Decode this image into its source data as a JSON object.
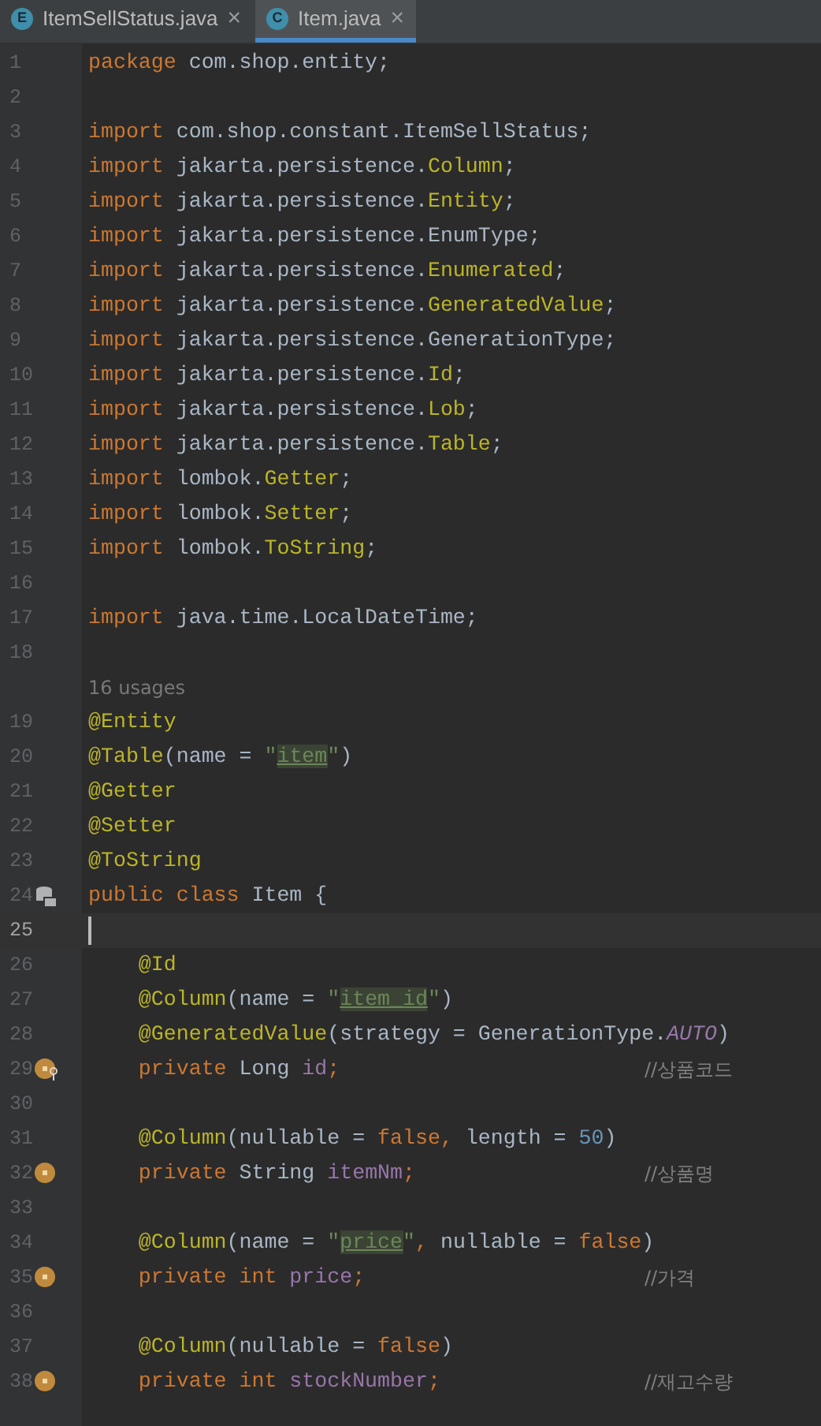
{
  "tabs": [
    {
      "label": "ItemSellStatus.java",
      "icon_letter": "E",
      "selected": false,
      "close": "×"
    },
    {
      "label": "Item.java",
      "icon_letter": "C",
      "selected": true,
      "close": "×"
    }
  ],
  "lines": [
    {
      "number": "1",
      "tokens": [
        {
          "text": "package",
          "kind": "keyword"
        },
        {
          "text": " com.shop.entity;",
          "kind": "plain"
        }
      ]
    },
    {
      "number": "2"
    },
    {
      "number": "3",
      "tokens": [
        {
          "text": "import",
          "kind": "keyword"
        },
        {
          "text": " com.shop.constant.ItemSellStatus;",
          "kind": "plain"
        }
      ]
    },
    {
      "number": "4",
      "tokens": [
        {
          "text": "import",
          "kind": "keyword"
        },
        {
          "text": " jakarta.persistence.",
          "kind": "plain"
        },
        {
          "text": "Column",
          "kind": "annotation"
        },
        {
          "text": ";",
          "kind": "plain"
        }
      ]
    },
    {
      "number": "5",
      "tokens": [
        {
          "text": "import",
          "kind": "keyword"
        },
        {
          "text": " jakarta.persistence.",
          "kind": "plain"
        },
        {
          "text": "Entity",
          "kind": "annotation"
        },
        {
          "text": ";",
          "kind": "plain"
        }
      ]
    },
    {
      "number": "6",
      "tokens": [
        {
          "text": "import",
          "kind": "keyword"
        },
        {
          "text": " jakarta.persistence.EnumType;",
          "kind": "plain"
        }
      ]
    },
    {
      "number": "7",
      "tokens": [
        {
          "text": "import",
          "kind": "keyword"
        },
        {
          "text": " jakarta.persistence.",
          "kind": "plain"
        },
        {
          "text": "Enumerated",
          "kind": "annotation"
        },
        {
          "text": ";",
          "kind": "plain"
        }
      ]
    },
    {
      "number": "8",
      "tokens": [
        {
          "text": "import",
          "kind": "keyword"
        },
        {
          "text": " jakarta.persistence.",
          "kind": "plain"
        },
        {
          "text": "GeneratedValue",
          "kind": "annotation"
        },
        {
          "text": ";",
          "kind": "plain"
        }
      ]
    },
    {
      "number": "9",
      "tokens": [
        {
          "text": "import",
          "kind": "keyword"
        },
        {
          "text": " jakarta.persistence.GenerationType;",
          "kind": "plain"
        }
      ]
    },
    {
      "number": "10",
      "tokens": [
        {
          "text": "import",
          "kind": "keyword"
        },
        {
          "text": " jakarta.persistence.",
          "kind": "plain"
        },
        {
          "text": "Id",
          "kind": "annotation"
        },
        {
          "text": ";",
          "kind": "plain"
        }
      ]
    },
    {
      "number": "11",
      "tokens": [
        {
          "text": "import",
          "kind": "keyword"
        },
        {
          "text": " jakarta.persistence.",
          "kind": "plain"
        },
        {
          "text": "Lob",
          "kind": "annotation"
        },
        {
          "text": ";",
          "kind": "plain"
        }
      ]
    },
    {
      "number": "12",
      "tokens": [
        {
          "text": "import",
          "kind": "keyword"
        },
        {
          "text": " jakarta.persistence.",
          "kind": "plain"
        },
        {
          "text": "Table",
          "kind": "annotation"
        },
        {
          "text": ";",
          "kind": "plain"
        }
      ]
    },
    {
      "number": "13",
      "tokens": [
        {
          "text": "import",
          "kind": "keyword"
        },
        {
          "text": " lombok.",
          "kind": "plain"
        },
        {
          "text": "Getter",
          "kind": "annotation"
        },
        {
          "text": ";",
          "kind": "plain"
        }
      ]
    },
    {
      "number": "14",
      "tokens": [
        {
          "text": "import",
          "kind": "keyword"
        },
        {
          "text": " lombok.",
          "kind": "plain"
        },
        {
          "text": "Setter",
          "kind": "annotation"
        },
        {
          "text": ";",
          "kind": "plain"
        }
      ]
    },
    {
      "number": "15",
      "tokens": [
        {
          "text": "import",
          "kind": "keyword"
        },
        {
          "text": " lombok.",
          "kind": "plain"
        },
        {
          "text": "ToString",
          "kind": "annotation"
        },
        {
          "text": ";",
          "kind": "plain"
        }
      ]
    },
    {
      "number": "16"
    },
    {
      "number": "17",
      "tokens": [
        {
          "text": "import",
          "kind": "keyword"
        },
        {
          "text": " java.time.LocalDateTime;",
          "kind": "plain"
        }
      ]
    },
    {
      "number": "18"
    },
    {
      "kind": "hint",
      "text": "16 usages"
    },
    {
      "number": "19",
      "tokens": [
        {
          "text": "@Entity",
          "kind": "annotation"
        }
      ]
    },
    {
      "number": "20",
      "tokens": [
        {
          "text": "@Table",
          "kind": "annotation"
        },
        {
          "text": "(name = ",
          "kind": "plain"
        },
        {
          "text": "\"",
          "kind": "string"
        },
        {
          "text": "item",
          "kind": "match"
        },
        {
          "text": "\"",
          "kind": "string"
        },
        {
          "text": ")",
          "kind": "plain"
        }
      ]
    },
    {
      "number": "21",
      "tokens": [
        {
          "text": "@Getter",
          "kind": "annotation"
        }
      ]
    },
    {
      "number": "22",
      "tokens": [
        {
          "text": "@Setter",
          "kind": "annotation"
        }
      ]
    },
    {
      "number": "23",
      "tokens": [
        {
          "text": "@ToString",
          "kind": "annotation"
        }
      ]
    },
    {
      "number": "24",
      "gutter_icon": {
        "kind": "table"
      },
      "tokens": [
        {
          "text": "public class",
          "kind": "keyword"
        },
        {
          "text": " Item {",
          "kind": "plain"
        }
      ]
    },
    {
      "number": "25",
      "current": true
    },
    {
      "number": "26",
      "tokens": [
        {
          "text": "    @Id",
          "kind": "annotation"
        }
      ]
    },
    {
      "number": "27",
      "tokens": [
        {
          "text": "    @Column",
          "kind": "annotation"
        },
        {
          "text": "(name = ",
          "kind": "plain"
        },
        {
          "text": "\"",
          "kind": "string"
        },
        {
          "text": "item_id",
          "kind": "match"
        },
        {
          "text": "\"",
          "kind": "string"
        },
        {
          "text": ")",
          "kind": "plain"
        }
      ]
    },
    {
      "number": "28",
      "tokens": [
        {
          "text": "    @GeneratedValue",
          "kind": "annotation"
        },
        {
          "text": "(strategy = GenerationType.",
          "kind": "plain"
        },
        {
          "text": "AUTO",
          "kind": "static"
        },
        {
          "text": ")",
          "kind": "plain"
        }
      ]
    },
    {
      "number": "29",
      "gutter_icon": {
        "kind": "field-key"
      },
      "tokens": [
        {
          "text": "    private",
          "kind": "keyword"
        },
        {
          "text": " Long ",
          "kind": "plain"
        },
        {
          "text": "id",
          "kind": "field"
        },
        {
          "text": ";",
          "kind": "keyword"
        }
      ],
      "comment": "//상품코드"
    },
    {
      "number": "30"
    },
    {
      "number": "31",
      "tokens": [
        {
          "text": "    @Column",
          "kind": "annotation"
        },
        {
          "text": "(nullable = ",
          "kind": "plain"
        },
        {
          "text": "false,",
          "kind": "keyword"
        },
        {
          "text": " length = ",
          "kind": "plain"
        },
        {
          "text": "50",
          "kind": "number"
        },
        {
          "text": ")",
          "kind": "plain"
        }
      ]
    },
    {
      "number": "32",
      "gutter_icon": {
        "kind": "field"
      },
      "tokens": [
        {
          "text": "    private",
          "kind": "keyword"
        },
        {
          "text": " String ",
          "kind": "plain"
        },
        {
          "text": "itemNm",
          "kind": "field"
        },
        {
          "text": ";",
          "kind": "keyword"
        }
      ],
      "comment": "//상품명"
    },
    {
      "number": "33"
    },
    {
      "number": "34",
      "tokens": [
        {
          "text": "    @Column",
          "kind": "annotation"
        },
        {
          "text": "(name = ",
          "kind": "plain"
        },
        {
          "text": "\"",
          "kind": "string"
        },
        {
          "text": "price",
          "kind": "match"
        },
        {
          "text": "\"",
          "kind": "string"
        },
        {
          "text": ",",
          "kind": "keyword"
        },
        {
          "text": " nullable = ",
          "kind": "plain"
        },
        {
          "text": "false",
          "kind": "keyword"
        },
        {
          "text": ")",
          "kind": "plain"
        }
      ]
    },
    {
      "number": "35",
      "gutter_icon": {
        "kind": "field"
      },
      "tokens": [
        {
          "text": "    private int ",
          "kind": "keyword"
        },
        {
          "text": "price",
          "kind": "field"
        },
        {
          "text": ";",
          "kind": "keyword"
        }
      ],
      "comment": "//가격"
    },
    {
      "number": "36"
    },
    {
      "number": "37",
      "tokens": [
        {
          "text": "    @Column",
          "kind": "annotation"
        },
        {
          "text": "(nullable = ",
          "kind": "plain"
        },
        {
          "text": "false",
          "kind": "keyword"
        },
        {
          "text": ")",
          "kind": "plain"
        }
      ]
    },
    {
      "number": "38",
      "gutter_icon": {
        "kind": "field"
      },
      "tokens": [
        {
          "text": "    private int ",
          "kind": "keyword"
        },
        {
          "text": "stockNumber",
          "kind": "field"
        },
        {
          "text": ";",
          "kind": "keyword"
        }
      ],
      "comment": "//재고수량"
    }
  ]
}
